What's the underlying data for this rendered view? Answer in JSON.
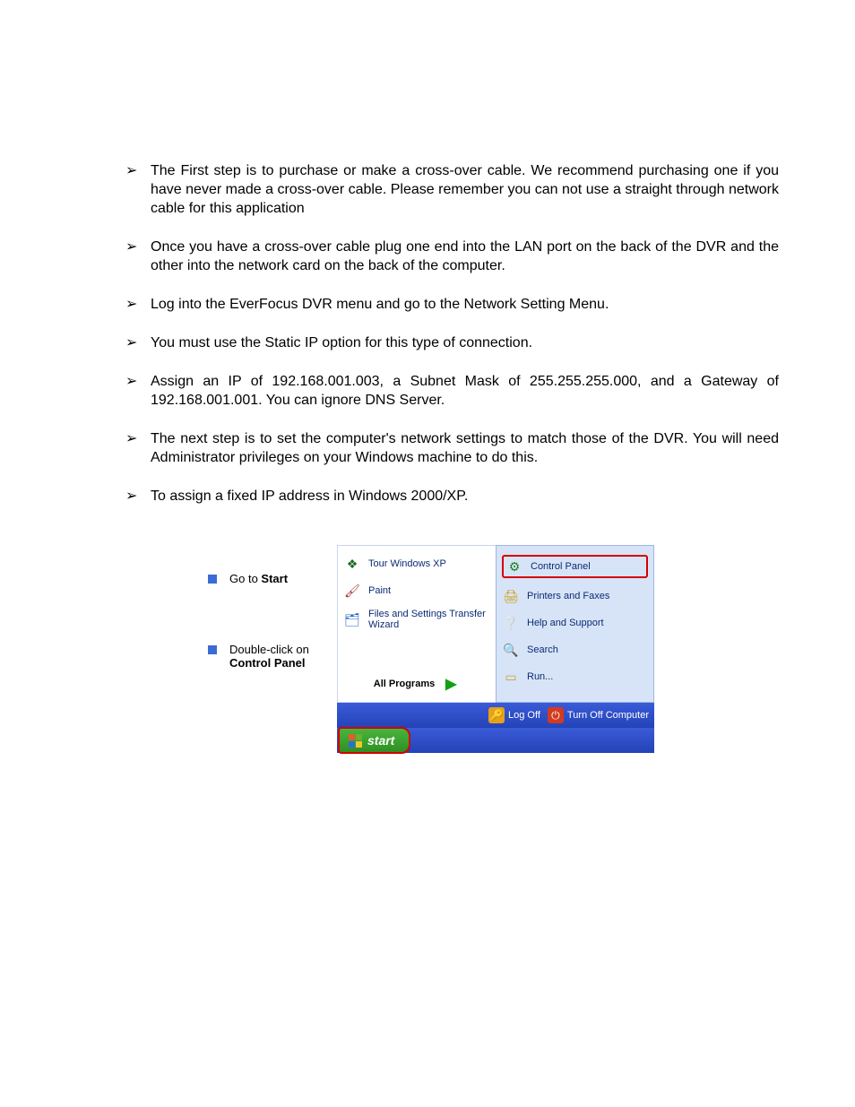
{
  "bullets": [
    "The First step is to purchase or make a cross-over cable. We recommend purchasing one if you have never made a cross-over cable. Please remember you can not use a straight through network cable for this application",
    "Once you have a cross-over cable plug one end into the LAN port on the back of the DVR and the other into the network card on the back of the computer.",
    "Log into the EverFocus DVR menu and go to the Network Setting Menu.",
    "You must use the Static IP option for this type of connection.",
    "Assign an IP of 192.168.001.003, a Subnet Mask of 255.255.255.000, and a Gateway of 192.168.001.001. You can ignore DNS Server.",
    "The next step is to set the computer's network settings to match those of the DVR. You will need Administrator privileges on your Windows machine to do this.",
    "To assign a fixed IP address in Windows 2000/XP."
  ],
  "side_steps": {
    "step1_prefix": "Go to ",
    "step1_bold": "Start",
    "step2_line1": "Double-click on",
    "step2_line2": "Control Panel"
  },
  "start_menu": {
    "left": {
      "tour": "Tour Windows XP",
      "paint": "Paint",
      "fst": "Files and Settings Transfer Wizard",
      "allprograms": "All Programs"
    },
    "right": {
      "control_panel": "Control Panel",
      "printers_faxes": "Printers and Faxes",
      "help_support": "Help and Support",
      "search": "Search",
      "run": "Run..."
    },
    "footer": {
      "logoff": "Log Off",
      "turnoff": "Turn Off Computer"
    },
    "taskbar": {
      "start": "start"
    }
  }
}
